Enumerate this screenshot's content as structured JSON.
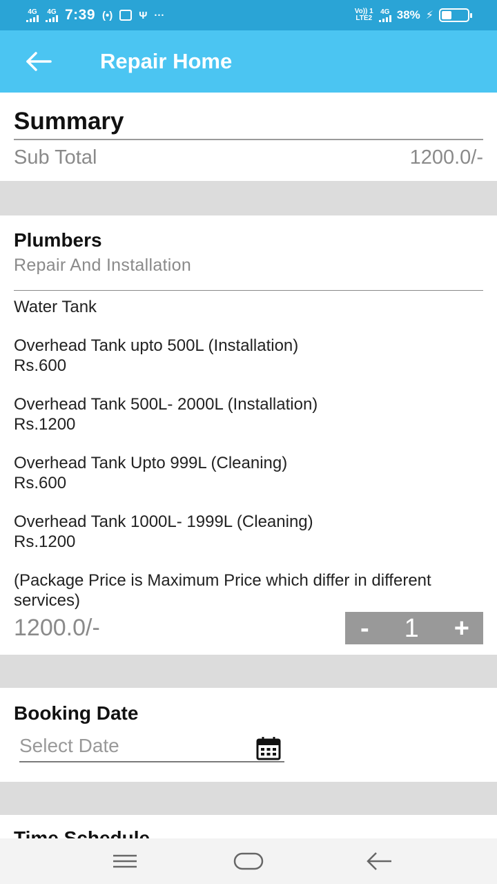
{
  "status_bar": {
    "net1": "4G",
    "net2": "4G",
    "time": "7:39",
    "extra_icons": "(•)",
    "more": "···",
    "volte_line1": "Vo)) 1",
    "volte_line2": "LTE2",
    "net3": "4G",
    "battery_pct_text": "38%",
    "battery_level": 0.38
  },
  "app_bar": {
    "title": "Repair Home",
    "back_icon": "arrow-left-icon"
  },
  "summary": {
    "title": "Summary",
    "subtotal_label": "Sub Total",
    "subtotal_value": "1200.0/-"
  },
  "service": {
    "category": "Plumbers",
    "subcategory": "Repair And Installation",
    "details": [
      "Water Tank",
      "",
      "Overhead Tank upto 500L (Installation)",
      "Rs.600",
      "",
      "Overhead Tank 500L- 2000L (Installation)",
      "Rs.1200",
      "",
      "Overhead Tank Upto 999L (Cleaning)",
      "Rs.600",
      "",
      "Overhead Tank 1000L- 1999L (Cleaning)",
      "Rs.1200",
      "",
      "(Package Price is Maximum Price which differ in different services)"
    ],
    "price": "1200.0/-",
    "stepper": {
      "minus": "-",
      "quantity": "1",
      "plus": "+"
    }
  },
  "booking": {
    "title": "Booking Date",
    "placeholder": "Select Date",
    "icon": "calendar-icon"
  },
  "time_schedule": {
    "title": "Time Schedule"
  },
  "nav_bar": {
    "menu_icon": "menu-icon",
    "home_icon": "home-icon",
    "back_icon": "back-icon"
  },
  "colors": {
    "status_bar": "#2aa4d6",
    "app_bar": "#4bc5f2",
    "divider_band": "#dcdcdc",
    "stepper": "#999999"
  }
}
